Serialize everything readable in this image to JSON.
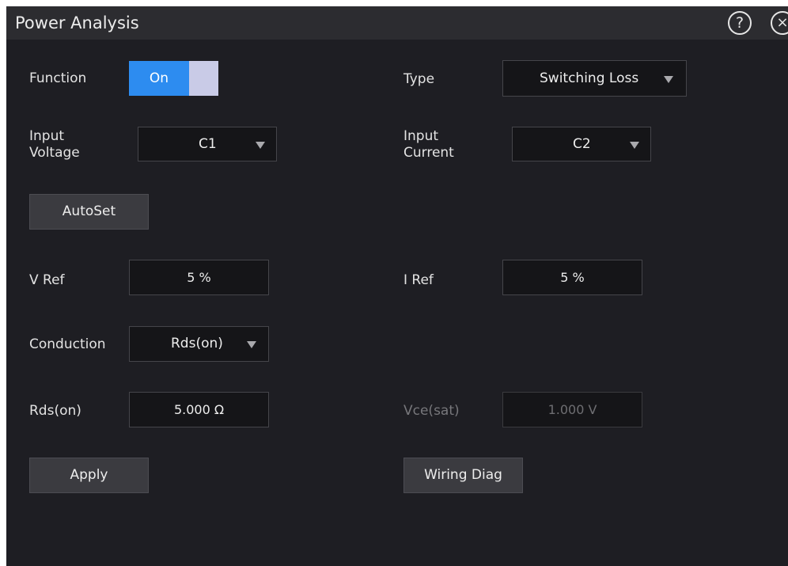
{
  "window": {
    "title": "Power Analysis",
    "help_glyph": "?",
    "close_glyph": "×"
  },
  "function": {
    "label": "Function",
    "toggle_state": "On"
  },
  "type": {
    "label": "Type",
    "value": "Switching Loss"
  },
  "input_voltage": {
    "label": "Input\nVoltage",
    "value": "C1"
  },
  "input_current": {
    "label": "Input\nCurrent",
    "value": "C2"
  },
  "autoset": {
    "label": "AutoSet"
  },
  "v_ref": {
    "label": "V Ref",
    "value": "5 %"
  },
  "i_ref": {
    "label": "I Ref",
    "value": "5 %"
  },
  "conduction": {
    "label": "Conduction",
    "value": "Rds(on)"
  },
  "rds_on": {
    "label": "Rds(on)",
    "value": "5.000 Ω"
  },
  "vce_sat": {
    "label": "Vce(sat)",
    "value": "1.000 V",
    "enabled": false
  },
  "apply": {
    "label": "Apply"
  },
  "wiring_diag": {
    "label": "Wiring Diag"
  },
  "colors": {
    "background": "#1e1e23",
    "titlebar": "#2c2c30",
    "accent": "#2d8cf0",
    "toggle_knob": "#c9cbe7",
    "field": "#151518",
    "button": "#3b3b40"
  }
}
